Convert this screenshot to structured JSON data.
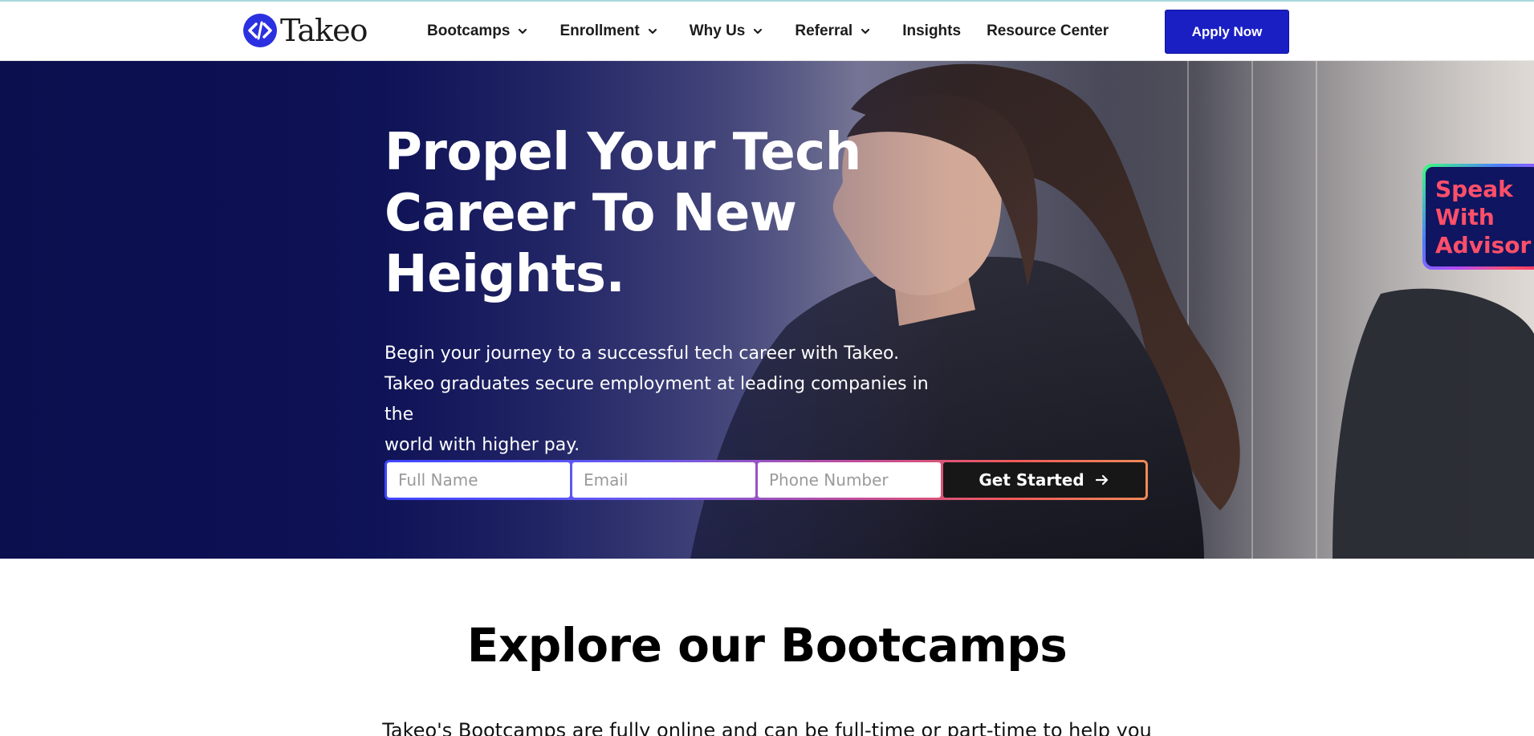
{
  "brand": {
    "name": "Takeo",
    "color": "#2b31e0"
  },
  "nav": {
    "items": [
      {
        "label": "Bootcamps",
        "dropdown": true
      },
      {
        "label": "Enrollment",
        "dropdown": true
      },
      {
        "label": "Why Us",
        "dropdown": true
      },
      {
        "label": "Referral",
        "dropdown": true
      },
      {
        "label": "Insights",
        "dropdown": false
      },
      {
        "label": "Resource Center",
        "dropdown": false
      }
    ],
    "cta_label": "Apply Now",
    "cta_color": "#1a1fc4"
  },
  "hero": {
    "title_lines": [
      "Propel Your Tech",
      "Career To New",
      "Heights."
    ],
    "subtitle_lines": [
      "Begin your journey to a successful tech career with Takeo.",
      "Takeo graduates secure employment at leading companies in the",
      "world with higher pay."
    ],
    "form": {
      "name_placeholder": "Full Name",
      "email_placeholder": "Email",
      "phone_placeholder": "Phone Number",
      "submit_label": "Get Started",
      "submit_icon": "arrow-right-icon"
    },
    "advisor_lines": [
      "Speak",
      "With",
      "Advisor"
    ],
    "advisor_text_color": "#ff4f6a"
  },
  "bootcamps": {
    "title": "Explore our Bootcamps",
    "intro": "Takeo's Bootcamps are fully online and can be full-time or part-time to help you"
  }
}
